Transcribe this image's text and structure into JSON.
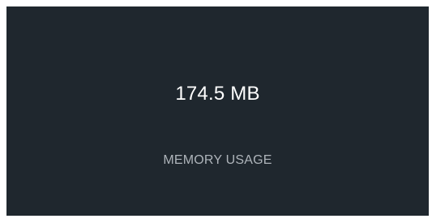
{
  "stat": {
    "value": "174.5 MB",
    "label": "MEMORY USAGE"
  },
  "colors": {
    "card_background": "#1f272e",
    "value_text": "#ffffff",
    "label_text": "#aeb4ba"
  }
}
